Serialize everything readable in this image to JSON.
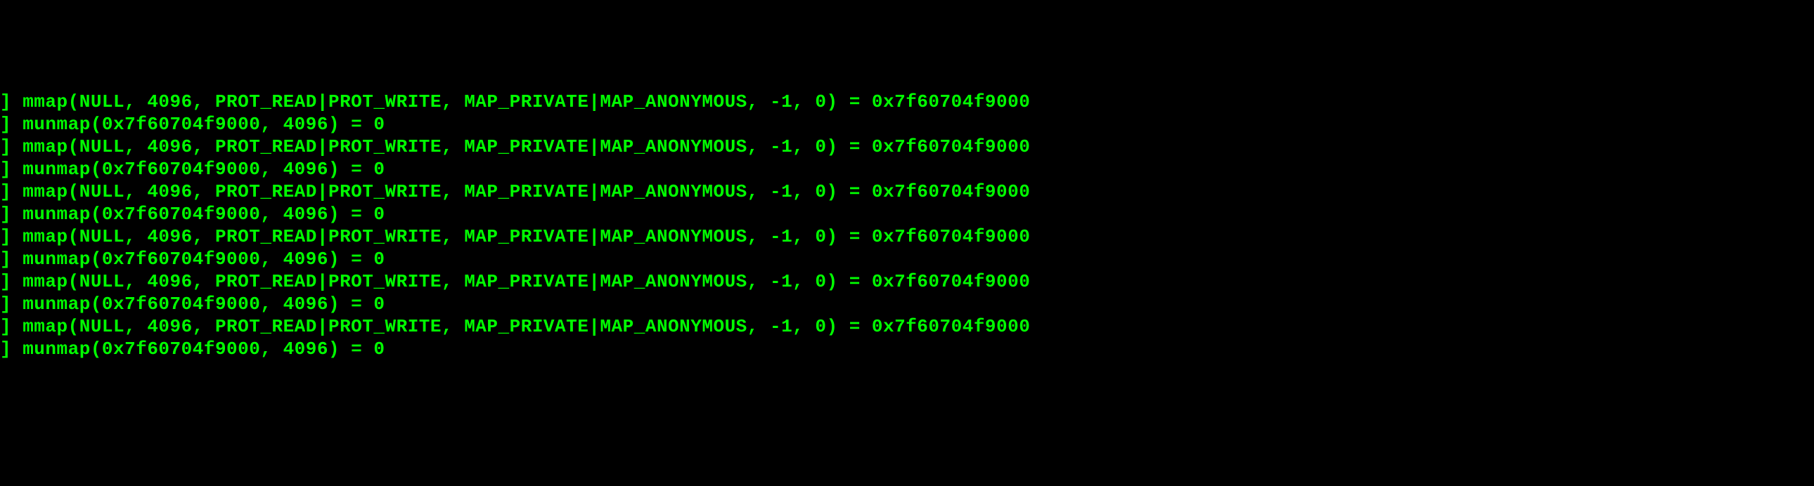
{
  "terminal": {
    "lines": [
      "] mmap(NULL, 4096, PROT_READ|PROT_WRITE, MAP_PRIVATE|MAP_ANONYMOUS, -1, 0) = 0x7f60704f9000",
      "] munmap(0x7f60704f9000, 4096) = 0",
      "] mmap(NULL, 4096, PROT_READ|PROT_WRITE, MAP_PRIVATE|MAP_ANONYMOUS, -1, 0) = 0x7f60704f9000",
      "] munmap(0x7f60704f9000, 4096) = 0",
      "] mmap(NULL, 4096, PROT_READ|PROT_WRITE, MAP_PRIVATE|MAP_ANONYMOUS, -1, 0) = 0x7f60704f9000",
      "] munmap(0x7f60704f9000, 4096) = 0",
      "] mmap(NULL, 4096, PROT_READ|PROT_WRITE, MAP_PRIVATE|MAP_ANONYMOUS, -1, 0) = 0x7f60704f9000",
      "] munmap(0x7f60704f9000, 4096) = 0",
      "] mmap(NULL, 4096, PROT_READ|PROT_WRITE, MAP_PRIVATE|MAP_ANONYMOUS, -1, 0) = 0x7f60704f9000",
      "] munmap(0x7f60704f9000, 4096) = 0",
      "] mmap(NULL, 4096, PROT_READ|PROT_WRITE, MAP_PRIVATE|MAP_ANONYMOUS, -1, 0) = 0x7f60704f9000",
      "] munmap(0x7f60704f9000, 4096) = 0"
    ]
  }
}
